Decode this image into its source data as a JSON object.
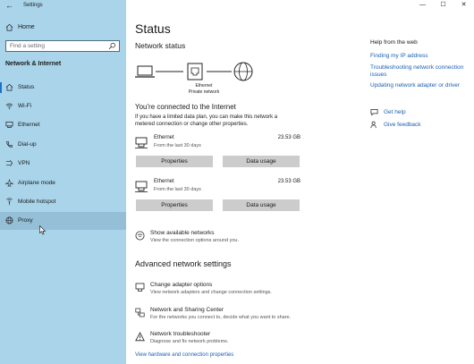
{
  "window": {
    "app_title": "Settings",
    "back_glyph": "←",
    "minimize_glyph": "—",
    "maximize_glyph": "☐",
    "close_glyph": "✕"
  },
  "sidebar": {
    "home_label": "Home",
    "search_placeholder": "Find a setting",
    "section_title": "Network & Internet",
    "items": [
      {
        "label": "Status",
        "icon": "home-globe-icon"
      },
      {
        "label": "Wi-Fi",
        "icon": "wifi-icon"
      },
      {
        "label": "Ethernet",
        "icon": "ethernet-icon"
      },
      {
        "label": "Dial-up",
        "icon": "phone-icon"
      },
      {
        "label": "VPN",
        "icon": "vpn-icon"
      },
      {
        "label": "Airplane mode",
        "icon": "airplane-icon"
      },
      {
        "label": "Mobile hotspot",
        "icon": "hotspot-icon"
      },
      {
        "label": "Proxy",
        "icon": "globe-icon"
      }
    ]
  },
  "main": {
    "title": "Status",
    "network_status_heading": "Network status",
    "diagram_label_1": "Ethernet",
    "diagram_label_2": "Private network",
    "connected_title": "You're connected to the Internet",
    "connected_desc": "If you have a limited data plan, you can make this network a metered connection or change other properties.",
    "adapters": [
      {
        "name": "Ethernet",
        "sub": "From the last 30 days",
        "size": "23.53 GB",
        "properties_label": "Properties",
        "data_usage_label": "Data usage"
      },
      {
        "name": "Ethernet",
        "sub": "From the last 30 days",
        "size": "23.53 GB",
        "properties_label": "Properties",
        "data_usage_label": "Data usage"
      }
    ],
    "show_networks": {
      "title": "Show available networks",
      "sub": "View the connection options around you."
    },
    "advanced_heading": "Advanced network settings",
    "advanced_items": [
      {
        "title": "Change adapter options",
        "sub": "View network adapters and change connection settings."
      },
      {
        "title": "Network and Sharing Center",
        "sub": "For the networks you connect to, decide what you want to share."
      },
      {
        "title": "Network troubleshooter",
        "sub": "Diagnose and fix network problems."
      }
    ],
    "hardware_link": "View hardware and connection properties"
  },
  "help": {
    "title": "Help from the web",
    "links": [
      "Finding my IP address",
      "Troubleshooting network connection issues",
      "Updating network adapter or driver"
    ],
    "get_help": "Get help",
    "give_feedback": "Give feedback"
  },
  "colors": {
    "sidebar_bg": "#a9d4ea",
    "accent": "#1a73c8",
    "link": "#1a5fb4",
    "button_bg": "#cccccc"
  }
}
